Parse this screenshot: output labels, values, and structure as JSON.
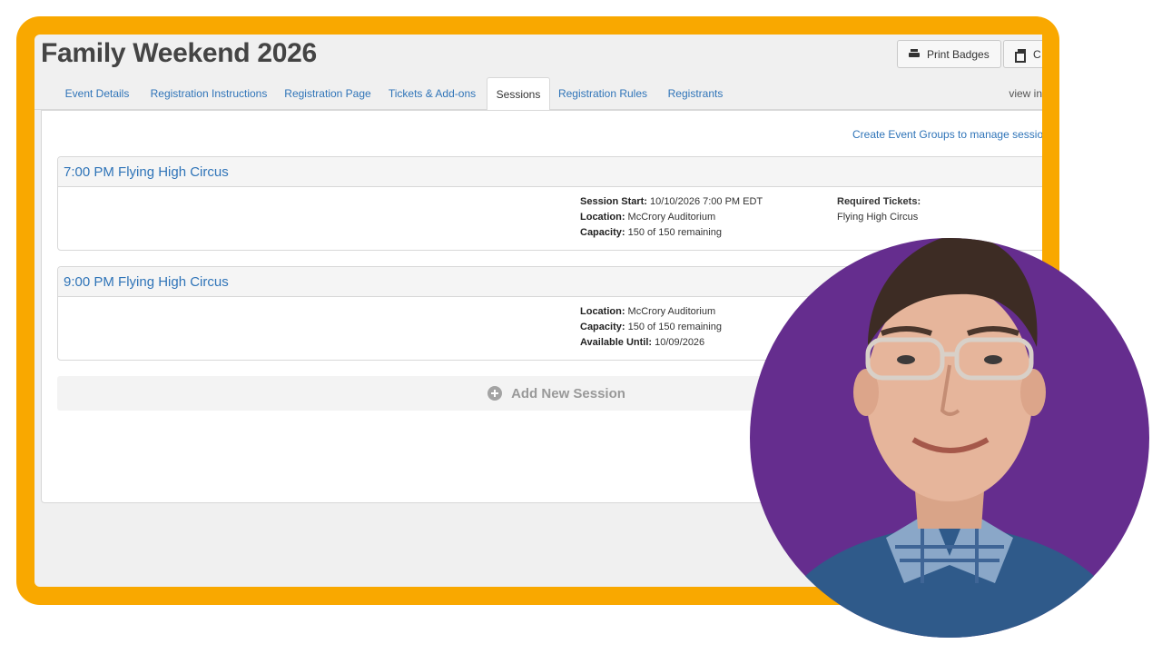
{
  "event": {
    "title": "Family Weekend 2026"
  },
  "toolbar": {
    "print_badges_label": "Print Badges",
    "copy_label": "C"
  },
  "tabs": [
    {
      "label": "Event Details"
    },
    {
      "label": "Registration Instructions"
    },
    {
      "label": "Registration Page"
    },
    {
      "label": "Tickets & Add-ons"
    },
    {
      "label": "Sessions"
    },
    {
      "label": "Registration Rules"
    },
    {
      "label": "Registrants"
    }
  ],
  "view_in_label": "view in",
  "groups_link": "Create Event Groups to manage sessions b",
  "sessions": [
    {
      "title": "7:00 PM Flying High Circus",
      "details": [
        {
          "label": "Session Start:",
          "value": " 10/10/2026 7:00 PM EDT"
        },
        {
          "label": "Location:",
          "value": " McCrory Auditorium"
        },
        {
          "label": "Capacity:",
          "value": " 150 of 150 remaining"
        }
      ],
      "required_tickets_label": "Required Tickets:",
      "required_tickets_value": "Flying High Circus"
    },
    {
      "title": "9:00 PM Flying High Circus",
      "details": [
        {
          "label": "Location:",
          "value": " McCrory Auditorium"
        },
        {
          "label": "Capacity:",
          "value": " 150 of 150 remaining"
        },
        {
          "label": "Available Until:",
          "value": " 10/09/2026"
        }
      ]
    }
  ],
  "add_session_label": "Add New Session",
  "colors": {
    "frame": "#f9a800",
    "link": "#2f74b8",
    "portrait_bg": "#652d8e"
  }
}
